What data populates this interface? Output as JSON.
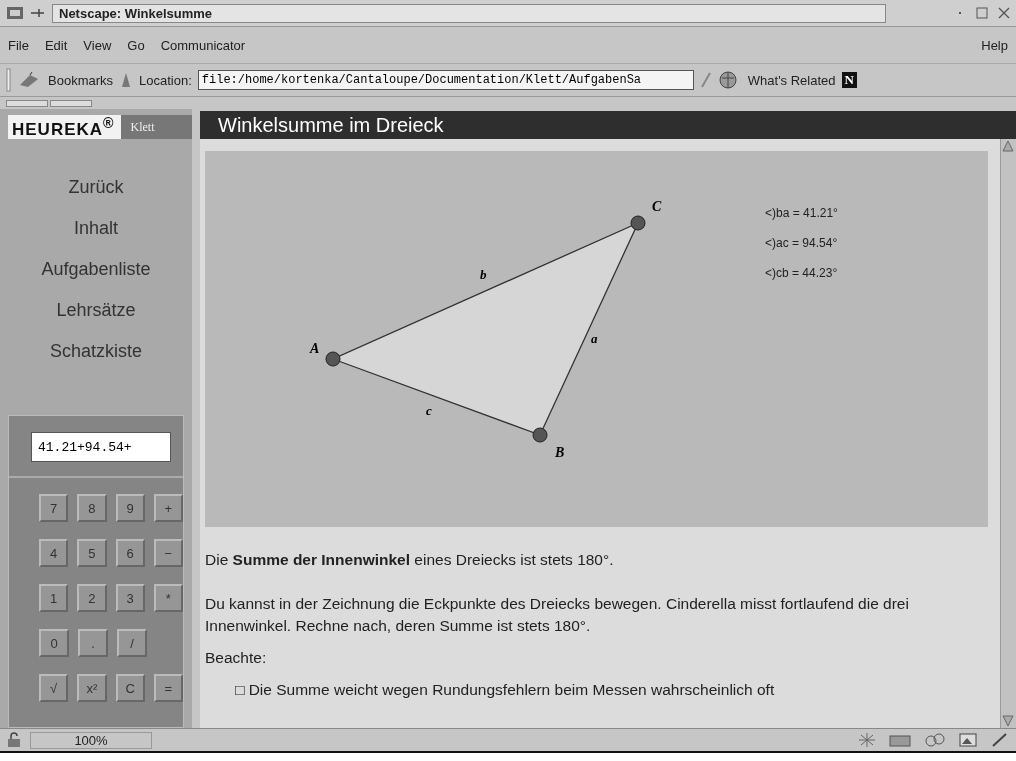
{
  "window": {
    "title": "Netscape: Winkelsumme"
  },
  "menu": [
    "File",
    "Edit",
    "View",
    "Go",
    "Communicator"
  ],
  "help_menu": "Help",
  "toolbar": {
    "bookmarks": "Bookmarks",
    "location_label": "Location:",
    "location": "file:/home/kortenka/Cantaloupe/Documentation/Klett/AufgabenSa",
    "related": "What's Related",
    "brand": "N"
  },
  "sidebar": {
    "logo": "HEUREKA$^{®}$",
    "publisher": "Klett",
    "items": [
      "Zurück",
      "Inhalt",
      "Aufgabenliste",
      "Lehrsätze",
      "Schatzkiste"
    ]
  },
  "calculator": {
    "display": "41.21+94.54+",
    "keys": [
      [
        "7",
        "8",
        "9",
        "+"
      ],
      [
        "4",
        "5",
        "6",
        "−"
      ],
      [
        "1",
        "2",
        "3",
        "*"
      ],
      [
        "0",
        ".",
        "/"
      ],
      [
        "√",
        "x²",
        "C",
        "="
      ]
    ]
  },
  "page": {
    "title": "Winkelsumme im Dreieck",
    "figure": {
      "points": [
        "A",
        "B",
        "C"
      ],
      "sides": [
        "a",
        "b",
        "c"
      ],
      "measurements": [
        "<)ba = 41.21°",
        "<)ac = 94.54°",
        "<)cb = 44.23°"
      ]
    },
    "paragraphs": [
      "Die **Summe der Innenwinkel** eines Dreiecks ist stets 180°.",
      "Du kannst in der Zeichnung die Eckpunkte des Dreiecks bewegen. Cinderella misst fortlaufend die drei Innenwinkel. Rechne nach, deren Summe ist stets 180°."
    ],
    "note_label": "Beachte:",
    "bullets": [
      "□ Die Summe weicht wegen Rundungsfehlern beim Messen wahrscheinlich oft"
    ]
  },
  "status_bar": {
    "zoom": "100%"
  }
}
